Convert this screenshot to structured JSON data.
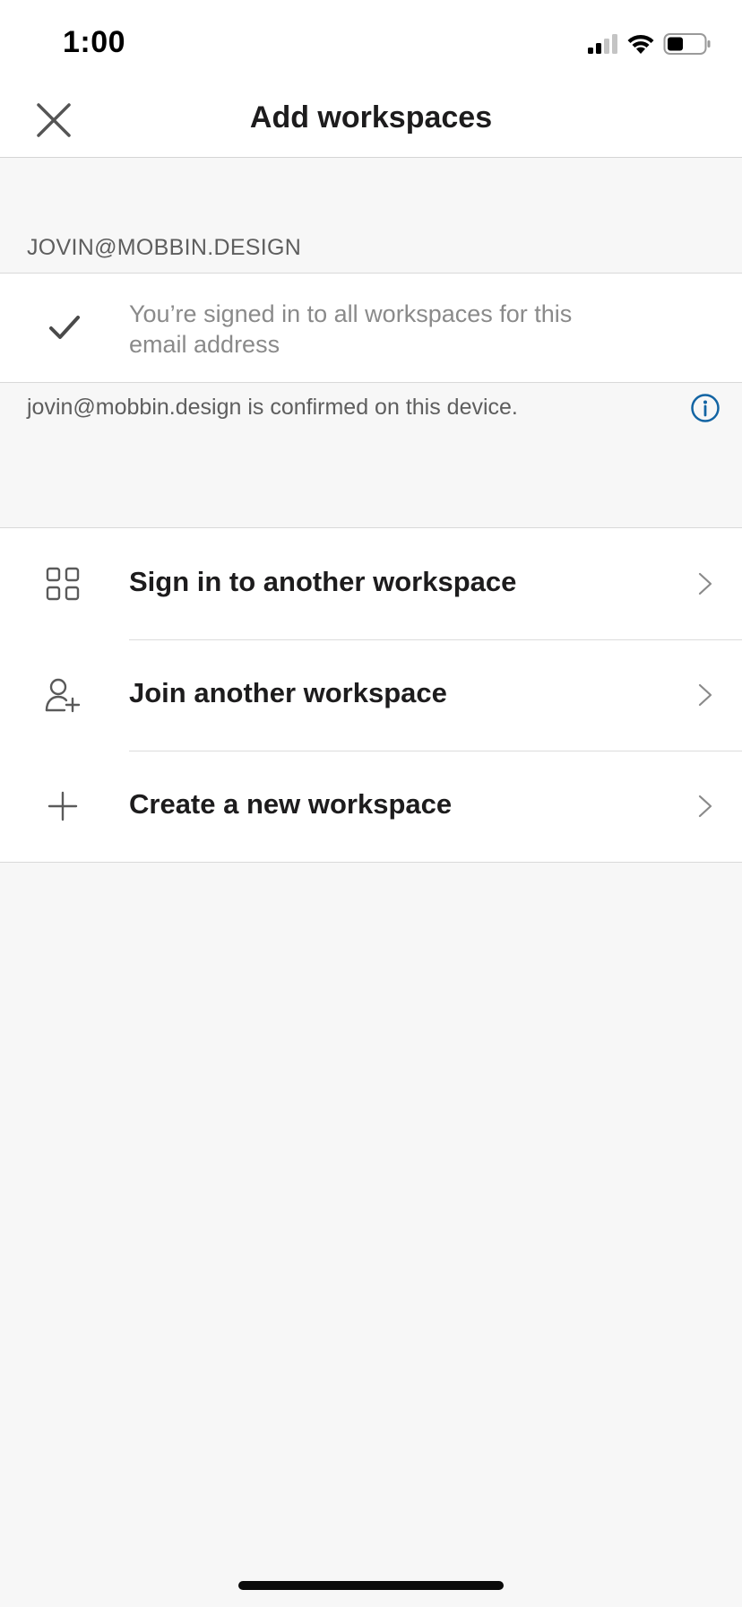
{
  "status_bar": {
    "time": "1:00",
    "signal_icon": "cellular-signal-icon",
    "wifi_icon": "wifi-icon",
    "battery_icon": "battery-icon"
  },
  "nav": {
    "title": "Add workspaces",
    "close_icon": "close-icon"
  },
  "account": {
    "email_header": "JOVIN@MOBBIN.DESIGN",
    "signed_in_message": "You’re signed in to all workspaces for this email address",
    "confirmed_message": "jovin@mobbin.design is confirmed on this device.",
    "info_color": "#1264a3"
  },
  "actions": [
    {
      "label": "Sign in to another workspace",
      "icon": "grid-icon"
    },
    {
      "label": "Join another workspace",
      "icon": "add-person-icon"
    },
    {
      "label": "Create a new workspace",
      "icon": "plus-icon"
    }
  ]
}
